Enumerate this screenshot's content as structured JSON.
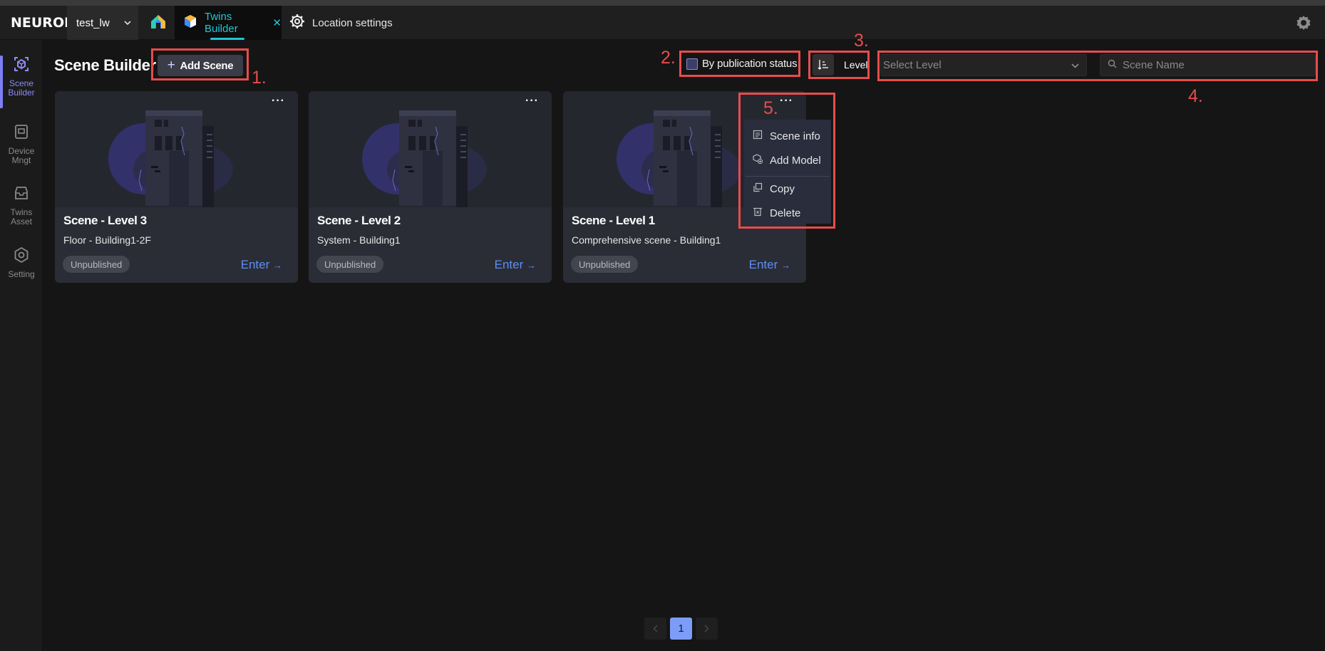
{
  "app": {
    "logo_text": "NEURON",
    "tenant": "test_lw"
  },
  "tabs": [
    {
      "label": "Twins Builder",
      "active": true
    },
    {
      "label": "Location settings",
      "active": false
    }
  ],
  "sidebar": {
    "items": [
      {
        "label": "Scene Builder",
        "icon": "scene-builder-icon",
        "active": true
      },
      {
        "label": "Device Mngt",
        "icon": "device-icon",
        "active": false
      },
      {
        "label": "Twins Asset",
        "icon": "asset-icon",
        "active": false
      },
      {
        "label": "Setting",
        "icon": "setting-icon",
        "active": false
      }
    ]
  },
  "header": {
    "title": "Scene Builder",
    "add_button": "Add Scene",
    "publication_filter": "By publication status",
    "sort_label": "Level",
    "level_placeholder": "Select Level",
    "search_placeholder": "Scene Name"
  },
  "annotations": [
    "1.",
    "2.",
    "3.",
    "4.",
    "5."
  ],
  "cards": [
    {
      "title": "Scene - Level 3",
      "subtitle": "Floor - Building1-2F",
      "status": "Unpublished",
      "enter": "Enter"
    },
    {
      "title": "Scene - Level 2",
      "subtitle": "System - Building1",
      "status": "Unpublished",
      "enter": "Enter"
    },
    {
      "title": "Scene - Level 1",
      "subtitle": "Comprehensive scene - Building1",
      "status": "Unpublished",
      "enter": "Enter"
    }
  ],
  "card_menu": {
    "items": [
      {
        "label": "Scene info",
        "icon": "document-icon"
      },
      {
        "label": "Add Model",
        "icon": "add-model-icon"
      },
      {
        "label": "Copy",
        "icon": "copy-icon"
      },
      {
        "label": "Delete",
        "icon": "delete-icon"
      }
    ]
  },
  "pagination": {
    "current": "1"
  },
  "colors": {
    "accent": "#22c6d6",
    "sidebar_active": "#8b8cf7",
    "link": "#5e8df6",
    "annotation": "#e84c4c",
    "page_active": "#7d9cf7"
  }
}
